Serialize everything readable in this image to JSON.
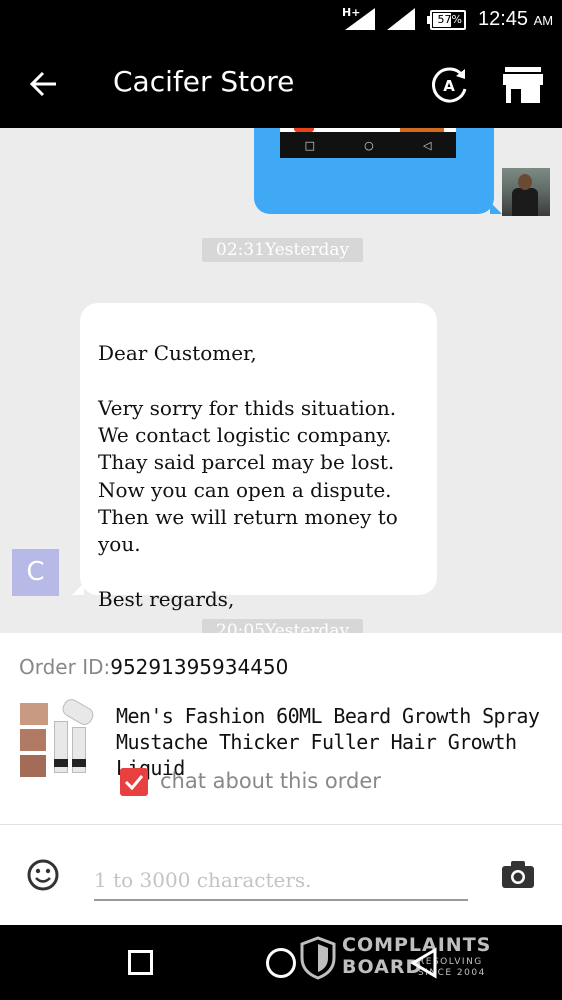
{
  "status_bar": {
    "network": "H+",
    "battery": "57%",
    "battery_level": 0.57,
    "time": "12:45",
    "time_suffix": "AM"
  },
  "app_bar": {
    "back_icon": "arrow-left-icon",
    "title": "Cacifer Store",
    "translate_icon": "translate-a-icon",
    "store_icon": "storefront-icon"
  },
  "chat": {
    "image_message": {
      "navbar_icons": [
        "square-icon",
        "circle-icon",
        "triangle-back-icon"
      ]
    },
    "timestamps": [
      "02:31Yesterday",
      "20:05Yesterday"
    ],
    "store_message": {
      "text": "Dear Customer,\n\n  Very sorry for thids situation. We contact logistic company. Thay said parcel may be lost. Now you can open a dispute. Then we will return money to you.\n\n  Best regards,"
    },
    "store_avatar_letter": "C"
  },
  "order": {
    "id_label": "Order ID:",
    "id_value": "95291395934450",
    "product_name": "Men's Fashion 60ML Beard Growth Spray Mustache Thicker Fuller Hair Growth Liquid",
    "chat_about_label": "chat about this order",
    "chat_about_checked": true
  },
  "composer": {
    "placeholder": "1 to 3000 characters.",
    "emoji_icon": "smiley-icon",
    "camera_icon": "camera-icon"
  },
  "watermark": {
    "line1": "COMPLAINTS",
    "line2": "BOARD",
    "line3": "RESOLVING\nSINCE 2004"
  },
  "colors": {
    "bar": "#000000",
    "chat_bg": "#ececec",
    "sent_bubble": "#3fa9f5",
    "checkbox": "#e84040",
    "store_avatar": "#b7b9e6"
  }
}
